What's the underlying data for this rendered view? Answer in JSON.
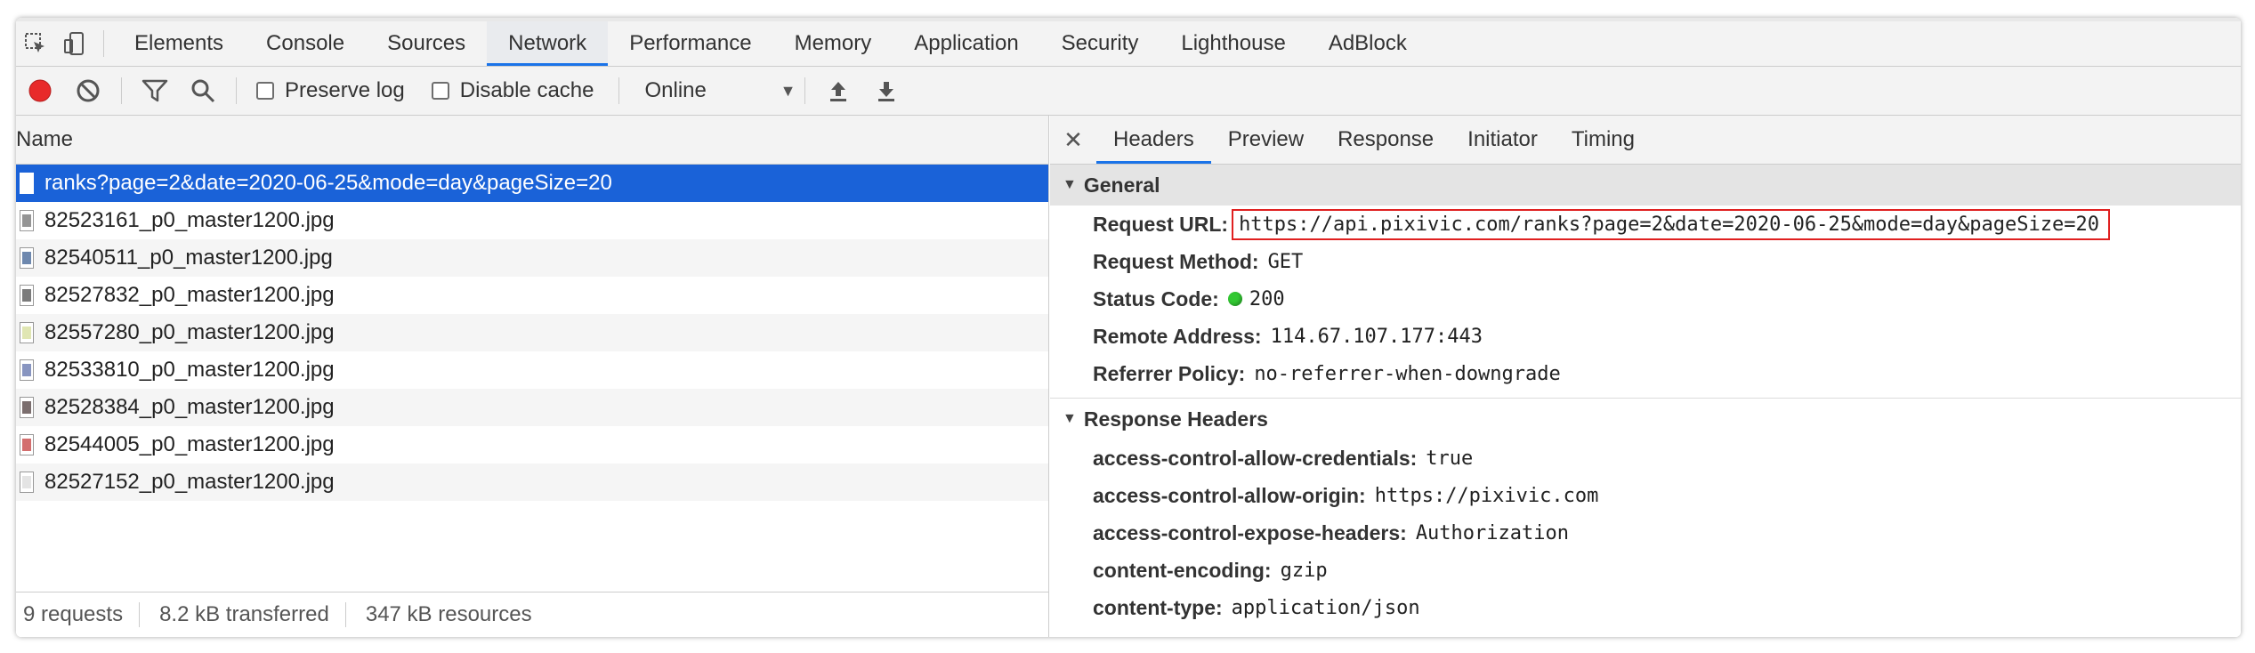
{
  "main_tabs": [
    "Elements",
    "Console",
    "Sources",
    "Network",
    "Performance",
    "Memory",
    "Application",
    "Security",
    "Lighthouse",
    "AdBlock"
  ],
  "active_main_tab": "Network",
  "toolbar": {
    "preserve_log": "Preserve log",
    "disable_cache": "Disable cache",
    "throttle": "Online",
    "record_color": "#e82a2a"
  },
  "requests": {
    "header": "Name",
    "rows": [
      "ranks?page=2&date=2020-06-25&mode=day&pageSize=20",
      "82523161_p0_master1200.jpg",
      "82540511_p0_master1200.jpg",
      "82527832_p0_master1200.jpg",
      "82557280_p0_master1200.jpg",
      "82533810_p0_master1200.jpg",
      "82528384_p0_master1200.jpg",
      "82544005_p0_master1200.jpg",
      "82527152_p0_master1200.jpg"
    ]
  },
  "status": {
    "requests": "9 requests",
    "transferred": "8.2 kB transferred",
    "resources": "347 kB resources"
  },
  "detail_tabs": [
    "Headers",
    "Preview",
    "Response",
    "Initiator",
    "Timing"
  ],
  "general": {
    "title": "General",
    "request_url_label": "Request URL:",
    "request_url": "https://api.pixivic.com/ranks?page=2&date=2020-06-25&mode=day&pageSize=20",
    "method_label": "Request Method:",
    "method": "GET",
    "status_label": "Status Code:",
    "status": "200",
    "remote_label": "Remote Address:",
    "remote": "114.67.107.177:443",
    "referrer_label": "Referrer Policy:",
    "referrer": "no-referrer-when-downgrade"
  },
  "response_headers": {
    "title": "Response Headers",
    "items": [
      {
        "k": "access-control-allow-credentials:",
        "v": "true"
      },
      {
        "k": "access-control-allow-origin:",
        "v": "https://pixivic.com"
      },
      {
        "k": "access-control-expose-headers:",
        "v": "Authorization"
      },
      {
        "k": "content-encoding:",
        "v": "gzip"
      },
      {
        "k": "content-type:",
        "v": "application/json"
      }
    ]
  }
}
